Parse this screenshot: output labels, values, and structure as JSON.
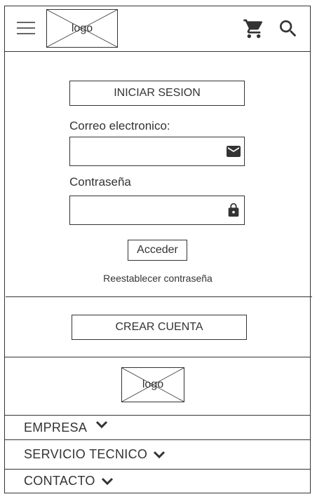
{
  "header": {
    "menu_icon": "hamburger-menu-icon",
    "logo_text": "logo",
    "cart_icon": "shopping-cart-icon",
    "search_icon": "search-icon"
  },
  "login": {
    "title_button": "INICIAR SESION",
    "email_label": "Correo electronico:",
    "email_value": "",
    "email_icon": "envelope-icon",
    "password_label": "Contraseña",
    "password_value": "",
    "password_icon": "lock-icon",
    "submit_label": "Acceder",
    "reset_link": "Reestablecer contraseña"
  },
  "signup": {
    "create_account_label": "CREAR CUENTA"
  },
  "footer": {
    "logo_text": "logo",
    "sections": [
      {
        "label": "EMPRESA",
        "icon": "chevron-down-icon"
      },
      {
        "label": "SERVICIO TECNICO",
        "icon": "chevron-down-icon"
      },
      {
        "label": "CONTACTO",
        "icon": "chevron-down-icon"
      }
    ]
  },
  "colors": {
    "stroke": "#333333",
    "background": "#ffffff"
  }
}
